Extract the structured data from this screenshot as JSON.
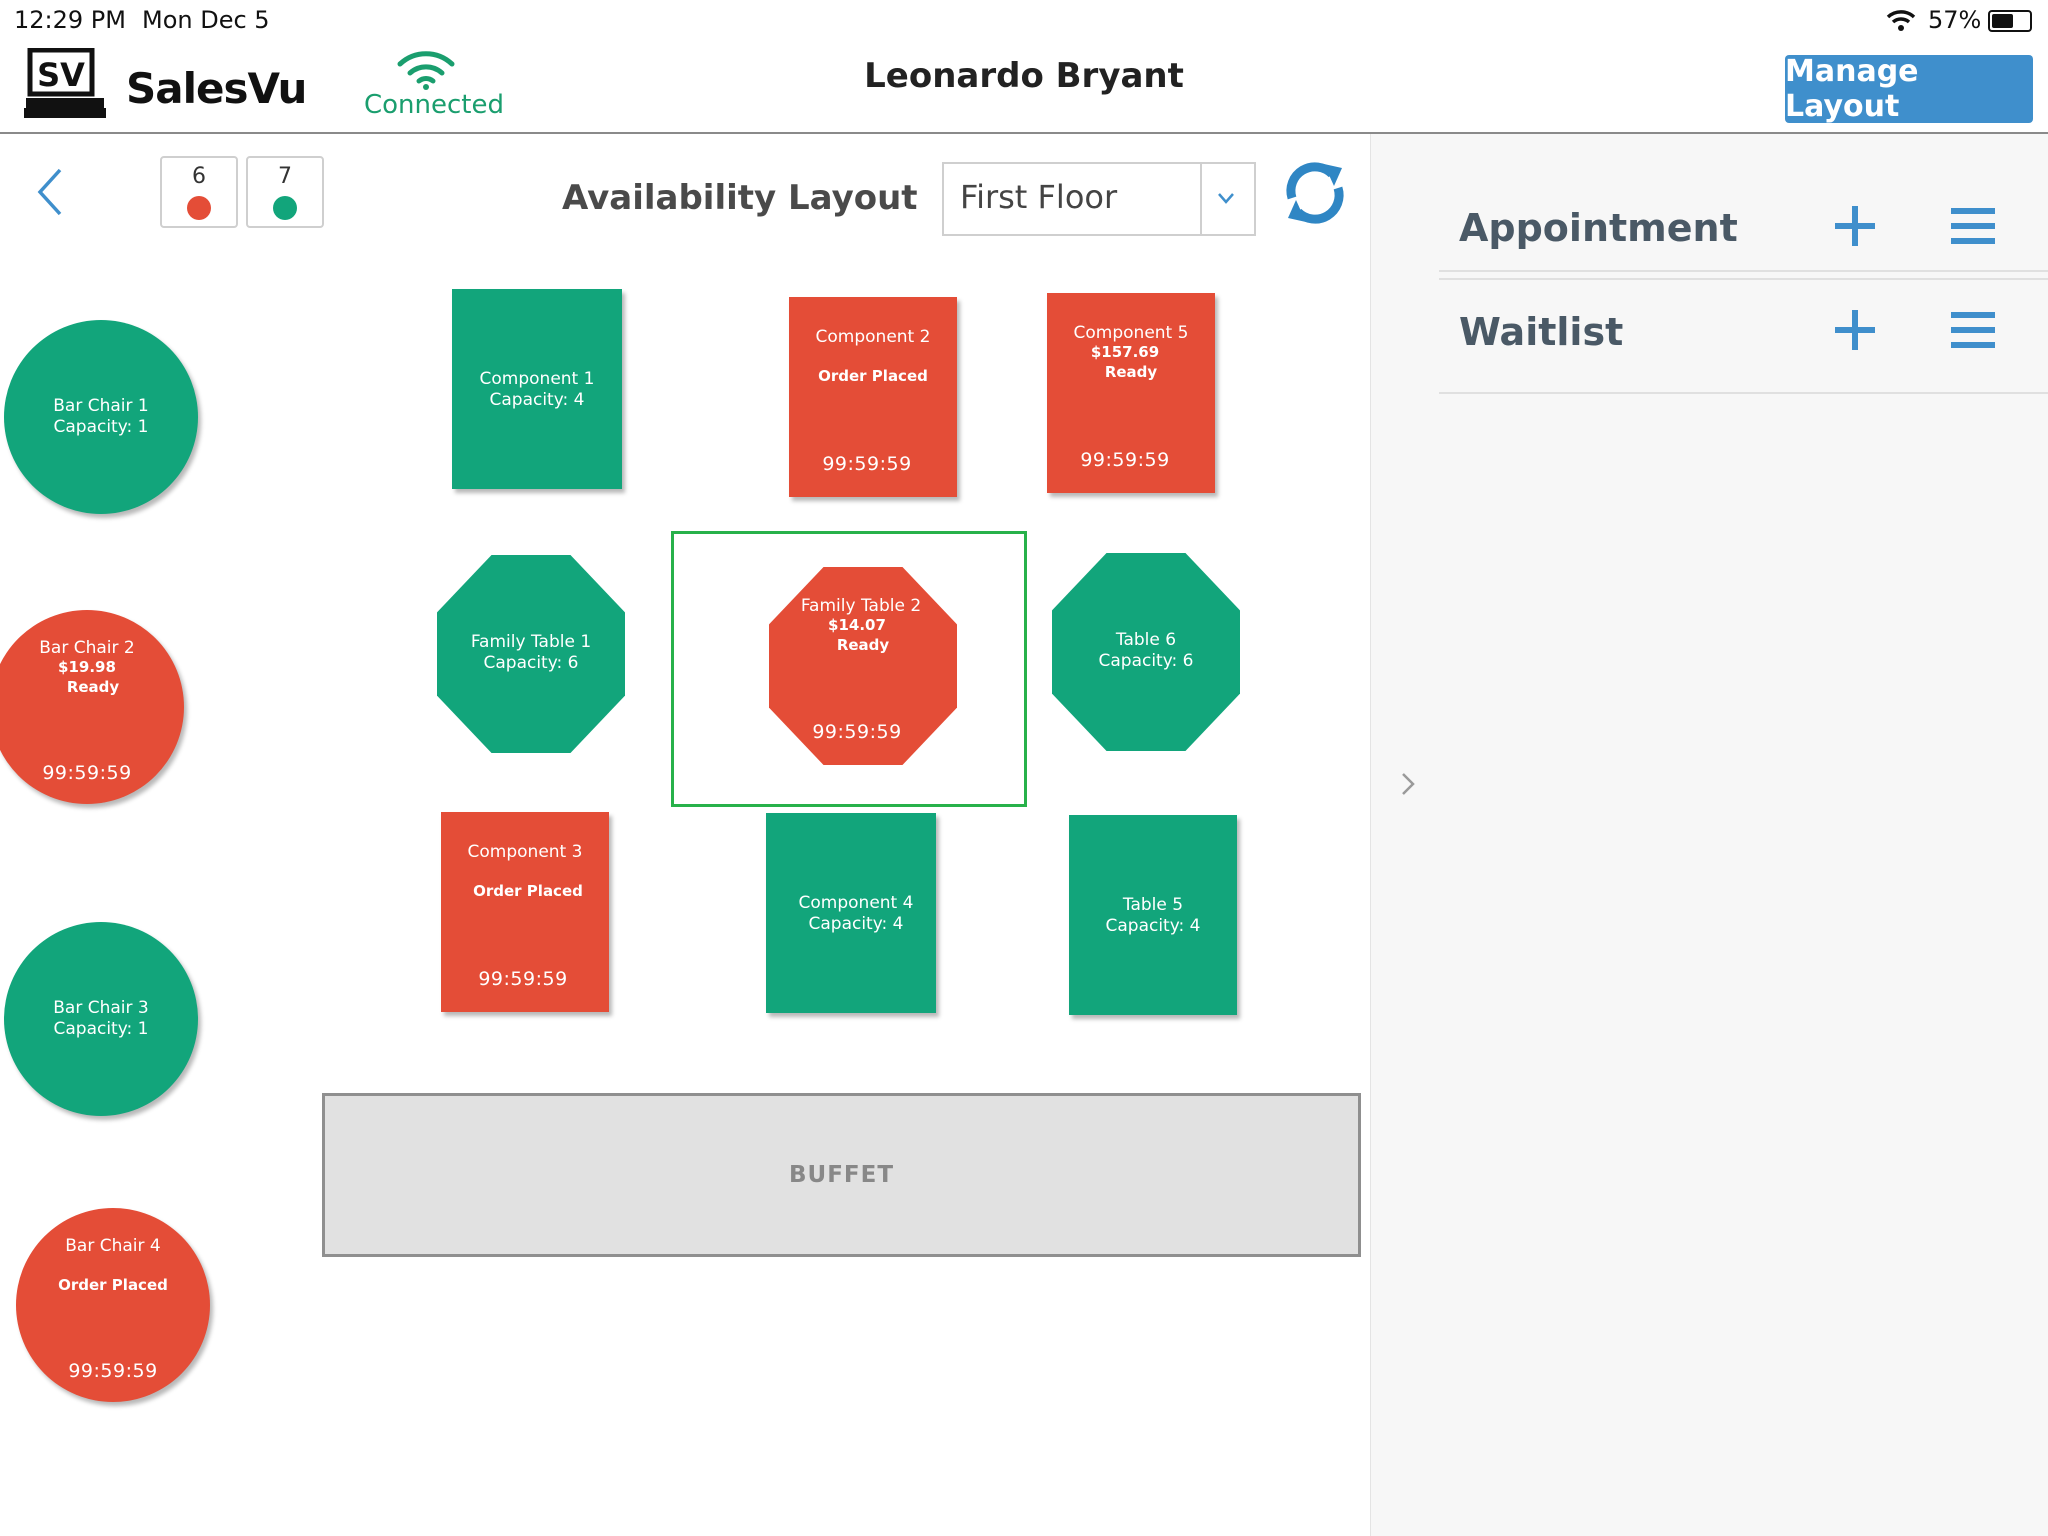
{
  "status_bar": {
    "time": "12:29 PM",
    "date": "Mon Dec 5",
    "battery": "57%"
  },
  "header": {
    "logo_text": "SalesVu",
    "logo_mark": "SV",
    "connection_status": "Connected",
    "user_name": "Leonardo Bryant",
    "manage_layout_label": "Manage Layout"
  },
  "toolbar": {
    "occupied_count": "6",
    "available_count": "7",
    "title": "Availability Layout",
    "floor_selected": "First Floor"
  },
  "colors": {
    "available": "#12a57b",
    "occupied": "#e44d37",
    "accent": "#3f8fcc",
    "selected_frame": "#27b14a"
  },
  "tables": {
    "bar_chair_1": {
      "name": "Bar Chair 1",
      "detail": "Capacity: 1",
      "status": "available"
    },
    "bar_chair_2": {
      "name": "Bar Chair 2",
      "price": "$19.98",
      "state": "Ready",
      "timer": "99:59:59",
      "status": "occupied"
    },
    "bar_chair_3": {
      "name": "Bar Chair 3",
      "detail": "Capacity: 1",
      "status": "available"
    },
    "bar_chair_4": {
      "name": "Bar Chair 4",
      "state": "Order Placed",
      "timer": "99:59:59",
      "status": "occupied"
    },
    "component_1": {
      "name": "Component 1",
      "detail": "Capacity: 4",
      "status": "available"
    },
    "component_2": {
      "name": "Component 2",
      "state": "Order Placed",
      "timer": "99:59:59",
      "status": "occupied"
    },
    "component_5": {
      "name": "Component 5",
      "price": "$157.69",
      "state": "Ready",
      "timer": "99:59:59",
      "status": "occupied"
    },
    "family_table_1": {
      "name": "Family Table 1",
      "detail": "Capacity: 6",
      "status": "available"
    },
    "family_table_2": {
      "name": "Family Table 2",
      "price": "$14.07",
      "state": "Ready",
      "timer": "99:59:59",
      "status": "occupied"
    },
    "table_6": {
      "name": "Table 6",
      "detail": "Capacity: 6",
      "status": "available"
    },
    "component_3": {
      "name": "Component 3",
      "state": "Order Placed",
      "timer": "99:59:59",
      "status": "occupied"
    },
    "component_4": {
      "name": "Component 4",
      "detail": "Capacity: 4",
      "status": "available"
    },
    "table_5": {
      "name": "Table 5",
      "detail": "Capacity: 4",
      "status": "available"
    }
  },
  "buffet_label": "BUFFET",
  "right_panel": {
    "appointment_label": "Appointment",
    "waitlist_label": "Waitlist"
  },
  "icons": [
    "wifi-icon",
    "battery-icon",
    "back-chevron-icon",
    "dropdown-chevron-icon",
    "refresh-icon",
    "plus-icon",
    "hamburger-menu-icon",
    "expand-chevron-icon"
  ]
}
